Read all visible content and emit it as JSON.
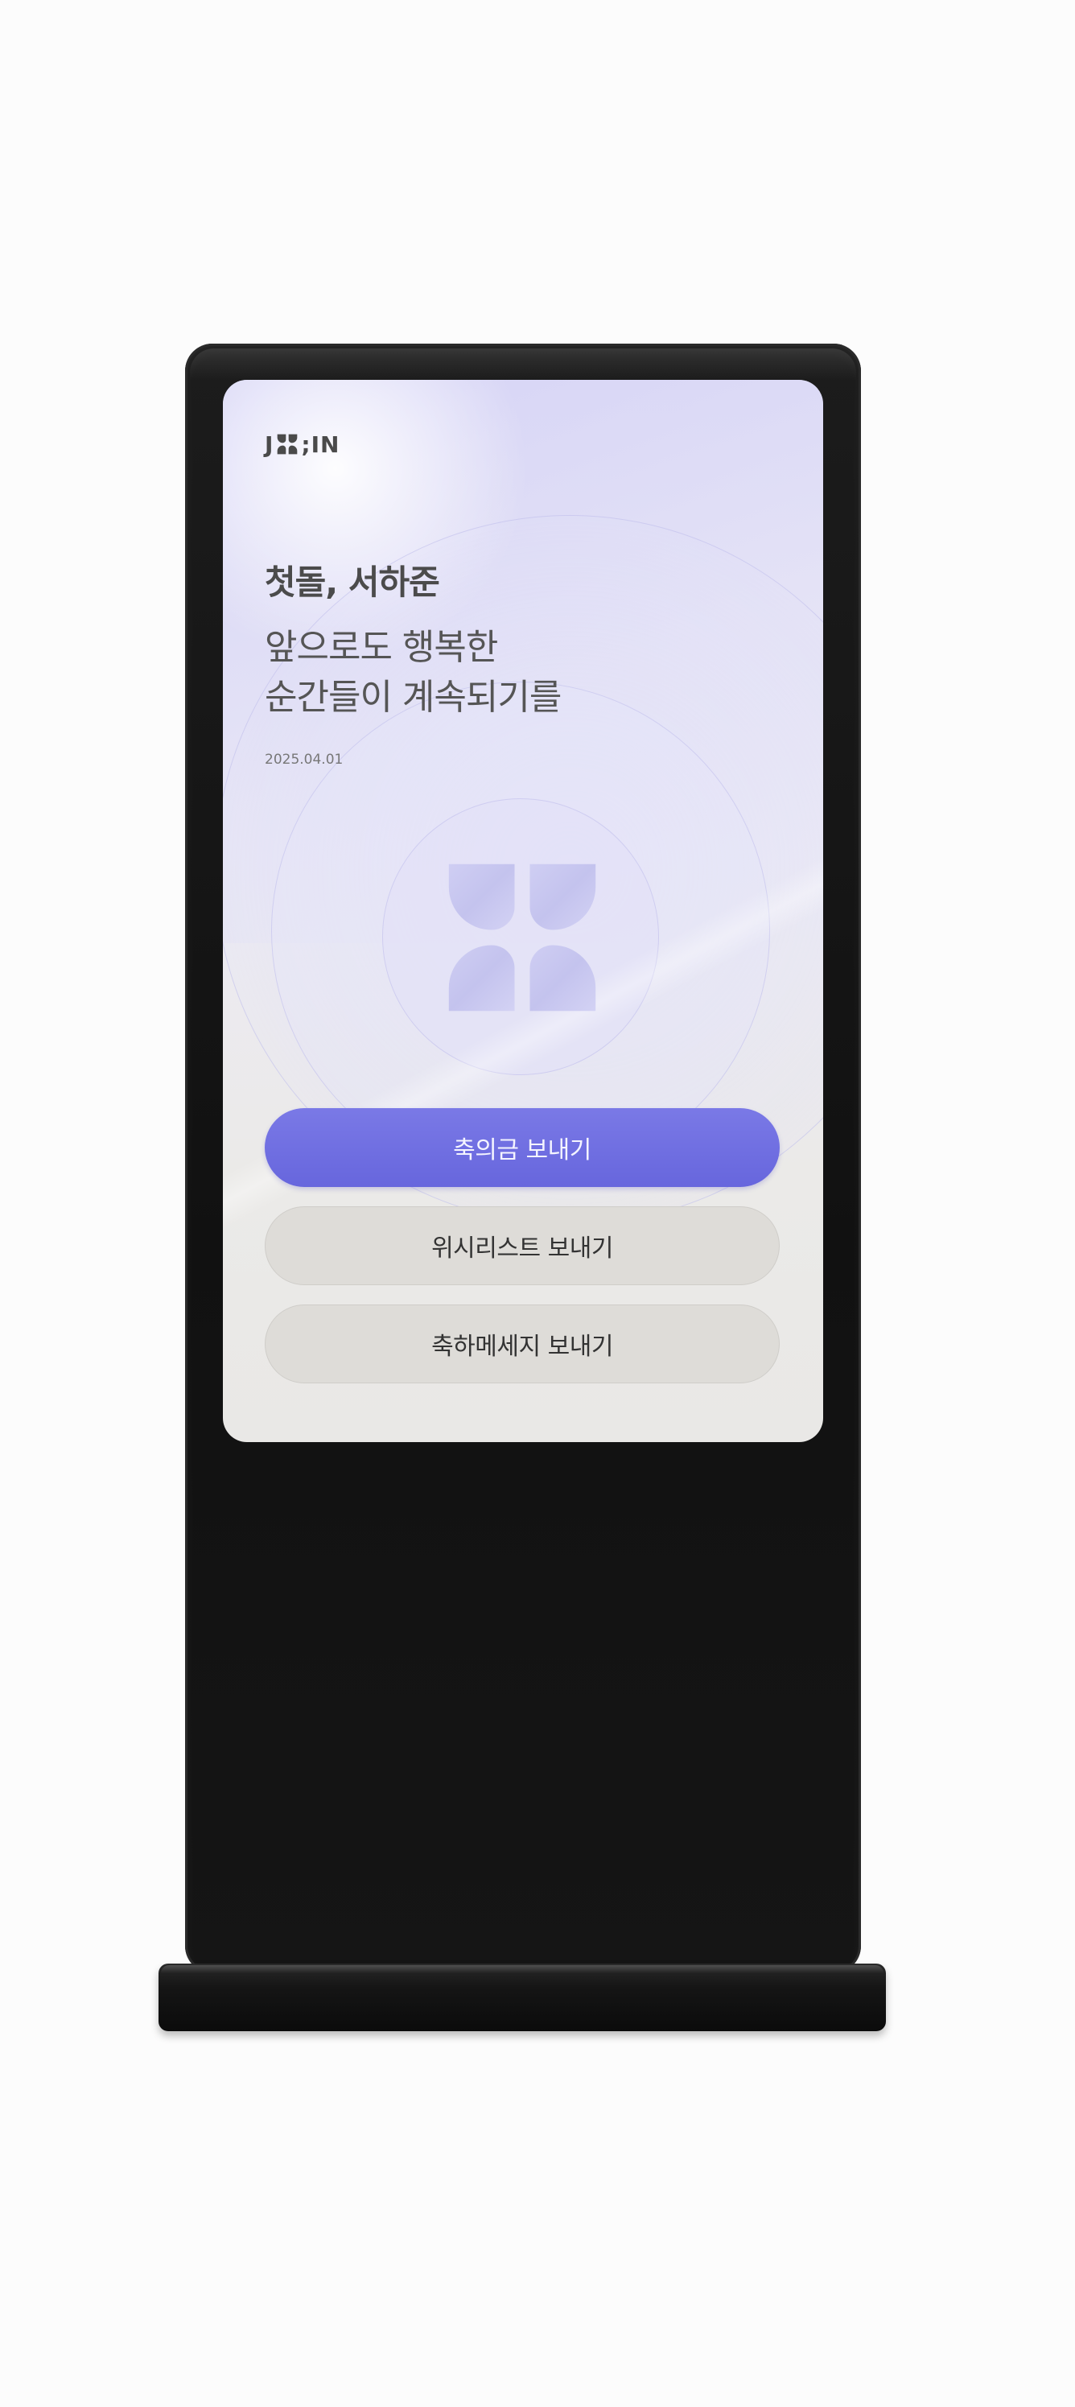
{
  "brand": {
    "logo_left": "J",
    "logo_right": ";IN",
    "logo_mark_icon": "clover-knot-icon"
  },
  "event": {
    "title": "첫돌, 서하준",
    "message_line1": "앞으로도 행복한",
    "message_line2": "순간들이 계속되기를",
    "date": "2025.04.01"
  },
  "emblem": {
    "icon": "clover-knot-icon"
  },
  "actions": {
    "gift_money": "축의금 보내기",
    "wishlist": "위시리스트 보내기",
    "congrats_message": "축하메세지 보내기"
  },
  "colors": {
    "primary_button": "#6f6ee2",
    "secondary_button": "#dedcd8",
    "kiosk_frame": "#141414",
    "emblem": "#c9c8ef"
  }
}
